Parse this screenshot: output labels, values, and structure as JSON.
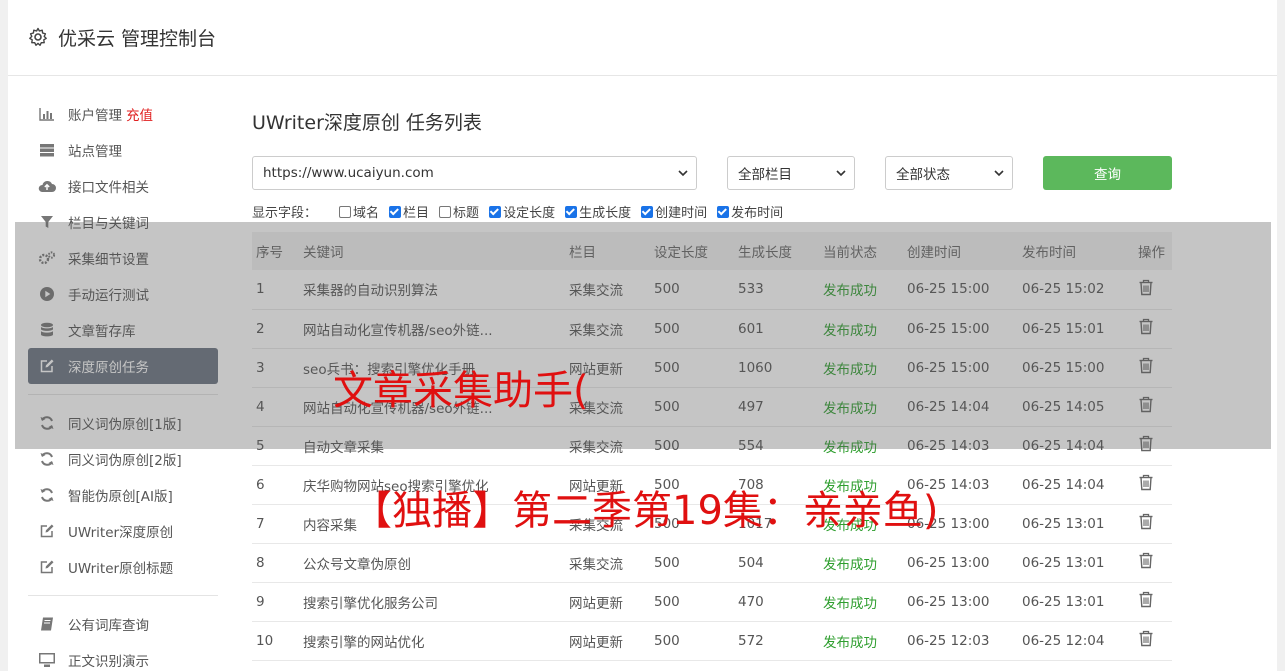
{
  "header": {
    "title": "优采云 管理控制台",
    "icon": "gear-icon"
  },
  "sidebar": {
    "groups": [
      [
        {
          "label": "账户管理",
          "badge": "充值",
          "icon": "bar-chart-icon"
        },
        {
          "label": "站点管理",
          "icon": "server-icon"
        },
        {
          "label": "接口文件相关",
          "icon": "cloud-upload-icon"
        },
        {
          "label": "栏目与关键词",
          "icon": "filter-icon"
        },
        {
          "label": "采集细节设置",
          "icon": "cogs-icon"
        },
        {
          "label": "手动运行测试",
          "icon": "play-circle-icon"
        },
        {
          "label": "文章暂存库",
          "icon": "database-icon"
        },
        {
          "label": "深度原创任务",
          "icon": "edit-icon",
          "active": true
        }
      ],
      [
        {
          "label": "同义词伪原创[1版]",
          "icon": "refresh-icon"
        },
        {
          "label": "同义词伪原创[2版]",
          "icon": "refresh-icon"
        },
        {
          "label": "智能伪原创[AI版]",
          "icon": "refresh-icon"
        },
        {
          "label": "UWriter深度原创",
          "icon": "edit-icon"
        },
        {
          "label": "UWriter原创标题",
          "icon": "edit-icon"
        }
      ],
      [
        {
          "label": "公有词库查询",
          "icon": "book-icon"
        },
        {
          "label": "正文识别演示",
          "icon": "monitor-icon"
        }
      ]
    ]
  },
  "main": {
    "title": "UWriter深度原创 任务列表",
    "site_select": "https://www.ucaiyun.com",
    "column_select": "全部栏目",
    "status_select": "全部状态",
    "query_label": "查询",
    "fields_label": "显示字段：",
    "fields": [
      {
        "label": "域名",
        "checked": false
      },
      {
        "label": "栏目",
        "checked": true
      },
      {
        "label": "标题",
        "checked": false
      },
      {
        "label": "设定长度",
        "checked": true
      },
      {
        "label": "生成长度",
        "checked": true
      },
      {
        "label": "创建时间",
        "checked": true
      },
      {
        "label": "发布时间",
        "checked": true
      }
    ],
    "columns": [
      "序号",
      "关键词",
      "栏目",
      "设定长度",
      "生成长度",
      "当前状态",
      "创建时间",
      "发布时间",
      "操作"
    ],
    "rows": [
      [
        "1",
        "采集器的自动识别算法",
        "采集交流",
        "500",
        "533",
        "发布成功",
        "06-25 15:00",
        "06-25 15:02"
      ],
      [
        "2",
        "网站自动化宣传机器/seo外链...",
        "采集交流",
        "500",
        "601",
        "发布成功",
        "06-25 15:00",
        "06-25 15:01"
      ],
      [
        "3",
        "seo兵书：搜索引擎优化手册",
        "网站更新",
        "500",
        "1060",
        "发布成功",
        "06-25 15:00",
        "06-25 15:00"
      ],
      [
        "4",
        "网站自动化宣传机器/seo外链...",
        "采集交流",
        "500",
        "497",
        "发布成功",
        "06-25 14:04",
        "06-25 14:05"
      ],
      [
        "5",
        "自动文章采集",
        "采集交流",
        "500",
        "554",
        "发布成功",
        "06-25 14:03",
        "06-25 14:04"
      ],
      [
        "6",
        "庆华购物网站seo搜索引擎优化",
        "网站更新",
        "500",
        "708",
        "发布成功",
        "06-25 14:03",
        "06-25 14:04"
      ],
      [
        "7",
        "内容采集",
        "采集交流",
        "500",
        "1017",
        "发布成功",
        "06-25 13:00",
        "06-25 13:01"
      ],
      [
        "8",
        "公众号文章伪原创",
        "采集交流",
        "500",
        "504",
        "发布成功",
        "06-25 13:00",
        "06-25 13:01"
      ],
      [
        "9",
        "搜索引擎优化服务公司",
        "网站更新",
        "500",
        "470",
        "发布成功",
        "06-25 13:00",
        "06-25 13:01"
      ],
      [
        "10",
        "搜索引擎的网站优化",
        "网站更新",
        "500",
        "572",
        "发布成功",
        "06-25 12:03",
        "06-25 12:04"
      ]
    ]
  },
  "watermark": {
    "line1": "文章采集助手(",
    "line2": "【独播】第二季第19集：亲亲鱼)"
  },
  "colors": {
    "accent_green": "#5cb85c",
    "status_green": "#2e9e2e",
    "watermark_red": "#e01010",
    "active_nav": "#6b7481"
  }
}
